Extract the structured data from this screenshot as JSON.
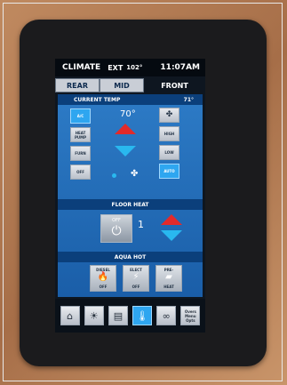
{
  "status": {
    "title": "CLIMATE",
    "ext_label": "EXT",
    "ext_temp": "102°",
    "time": "11:07AM"
  },
  "tabs": [
    {
      "label": "REAR",
      "active": false
    },
    {
      "label": "MID",
      "active": false
    },
    {
      "label": "FRONT",
      "active": true
    }
  ],
  "current_temp": {
    "label": "CURRENT TEMP",
    "value": "71°"
  },
  "mode_buttons": [
    {
      "label": "A/C",
      "active": true
    },
    {
      "label": "HEAT PUMP",
      "active": false
    },
    {
      "label": "FURN",
      "active": false
    },
    {
      "label": "OFF",
      "active": false
    }
  ],
  "setpoint": "70°",
  "fan_buttons": [
    {
      "icon": "fan-icon",
      "label": "✤",
      "active": false
    },
    {
      "label": "HIGH",
      "active": false
    },
    {
      "label": "LOW",
      "active": false
    },
    {
      "label": "AUTO",
      "active": true
    }
  ],
  "floor_heat": {
    "label": "FLOOR HEAT",
    "button_label": "OFF",
    "level": "1"
  },
  "aqua_hot": {
    "label": "AQUA HOT",
    "buttons": [
      {
        "top": "DIESEL",
        "icon": "flame-icon",
        "glyph": "🔥",
        "bottom": "OFF"
      },
      {
        "top": "ELECT",
        "icon": "lightning-icon",
        "glyph": "⚡",
        "bottom": "OFF"
      },
      {
        "top": "PRE-",
        "icon": "engine-icon",
        "glyph": "▰",
        "bottom": "HEAT"
      }
    ]
  },
  "nav": [
    {
      "icon": "home-icon",
      "glyph": "⌂"
    },
    {
      "icon": "light-bulb-icon",
      "glyph": "☀"
    },
    {
      "icon": "shade-icon",
      "glyph": "▤"
    },
    {
      "icon": "thermometer-icon",
      "glyph": "🌡",
      "active": true
    },
    {
      "icon": "chain-link-icon",
      "glyph": "∞"
    },
    {
      "icon": "menu-text-icon",
      "label": "Overs Menu Opts"
    }
  ],
  "colors": {
    "active_blue": "#2ea6f0",
    "panel_blue": "#2d7bc6",
    "heat_red": "#e22a2a",
    "cool_blue": "#29b8ef"
  }
}
